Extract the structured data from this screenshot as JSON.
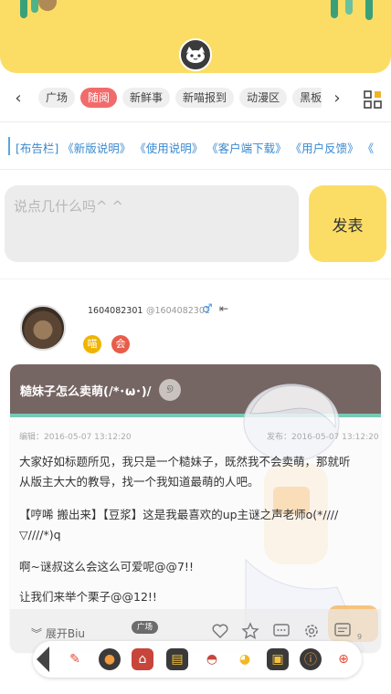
{
  "nav": {
    "tabs": [
      "广场",
      "随阅",
      "新鲜事",
      "新喵报到",
      "动漫区",
      "黑板"
    ],
    "active_tab": "随阅"
  },
  "notice": {
    "text": "[布告栏] 《新版说明》 《使用说明》 《客户端下载》 《用户反馈》 《"
  },
  "composer": {
    "placeholder": "说点几什么吗^ ^",
    "send_label": "发表"
  },
  "post": {
    "username": "1604082301",
    "handle": "@1604082301",
    "gender_symbol": "♂",
    "badges": [
      "喵",
      "会"
    ],
    "title": "糙妹子怎么卖萌(/*･ω･)/",
    "edited": "编辑：2016-05-07 13:12:20",
    "published": "发布：2016-05-07 13:12:20",
    "paragraphs": [
      "大家好如标题所见，我只是一个糙妹子，既然我不会卖萌，那就听从版主大大的教导，找一个我知道最萌的人吧。",
      "【哼唏 搬出来】【豆浆】这是我最喜欢的up主谜之声老师o(*////▽////*)q",
      "啊~谜叔这么会这么可爱呢@@7!!",
      "让我们来举个栗子@@12!!"
    ],
    "expand_label": "展开Biu",
    "category": "广场",
    "comment_count": "9"
  },
  "colors": {
    "header_yellow": "#fbdd66",
    "active_tab_red": "#f26b6b",
    "notice_blue": "#3a8ad0",
    "card_title_bg": "#756563",
    "card_accent": "#77c9b4"
  },
  "icons": {
    "prev": "chevron-left-icon",
    "next": "chevron-right-icon",
    "grid": "grid-menu-icon",
    "like": "heart-icon",
    "favorite": "star-icon",
    "comment": "comment-icon",
    "settings": "gear-icon",
    "reply": "reply-icon"
  }
}
